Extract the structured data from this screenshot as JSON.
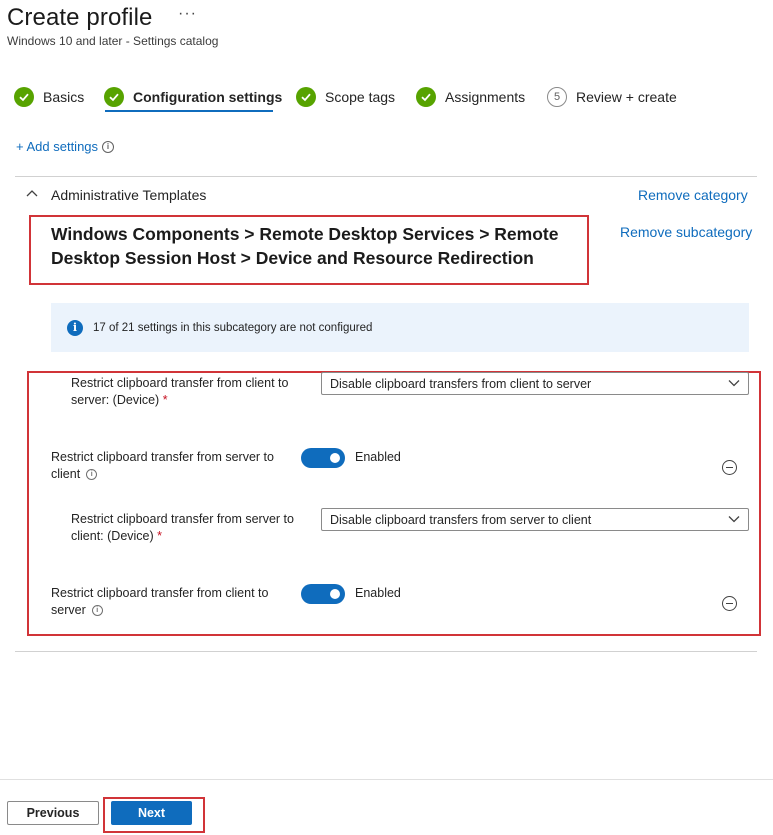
{
  "header": {
    "title": "Create profile",
    "more": "···",
    "subtitle": "Windows 10 and later - Settings catalog"
  },
  "steps": [
    {
      "label": "Basics",
      "status": "complete"
    },
    {
      "label": "Configuration settings",
      "status": "active"
    },
    {
      "label": "Scope tags",
      "status": "complete"
    },
    {
      "label": "Assignments",
      "status": "complete"
    },
    {
      "label": "Review + create",
      "status": "pending",
      "number": "5"
    }
  ],
  "add_settings": {
    "label": "+ Add settings",
    "info": "i"
  },
  "category": {
    "title": "Administrative Templates",
    "remove_category": "Remove category",
    "remove_subcategory": "Remove subcategory",
    "subcategory_title": "Windows Components > Remote Desktop Services > Remote Desktop Session Host > Device and Resource Redirection"
  },
  "info_bar": {
    "icon": "i",
    "text": "17 of 21 settings in this subcategory are not configured"
  },
  "settings": {
    "s1": {
      "label_line1": "Restrict clipboard transfer from client to",
      "label_line2": "server: (Device)",
      "required": "*",
      "value": "Disable clipboard transfers from client to server"
    },
    "s2": {
      "label_line1": "Restrict clipboard transfer from server to",
      "label_line2": "client",
      "info": "i",
      "toggle_text": "Enabled"
    },
    "s3": {
      "label_line1": "Restrict clipboard transfer from server to",
      "label_line2": "client: (Device)",
      "required": "*",
      "value": "Disable clipboard transfers from server to client"
    },
    "s4": {
      "label_line1": "Restrict clipboard transfer from client to",
      "label_line2": "server",
      "info": "i",
      "toggle_text": "Enabled"
    }
  },
  "footer": {
    "previous": "Previous",
    "next": "Next"
  },
  "colors": {
    "accent": "#0f6cbd",
    "success": "#57a300",
    "highlight": "#d13438"
  }
}
